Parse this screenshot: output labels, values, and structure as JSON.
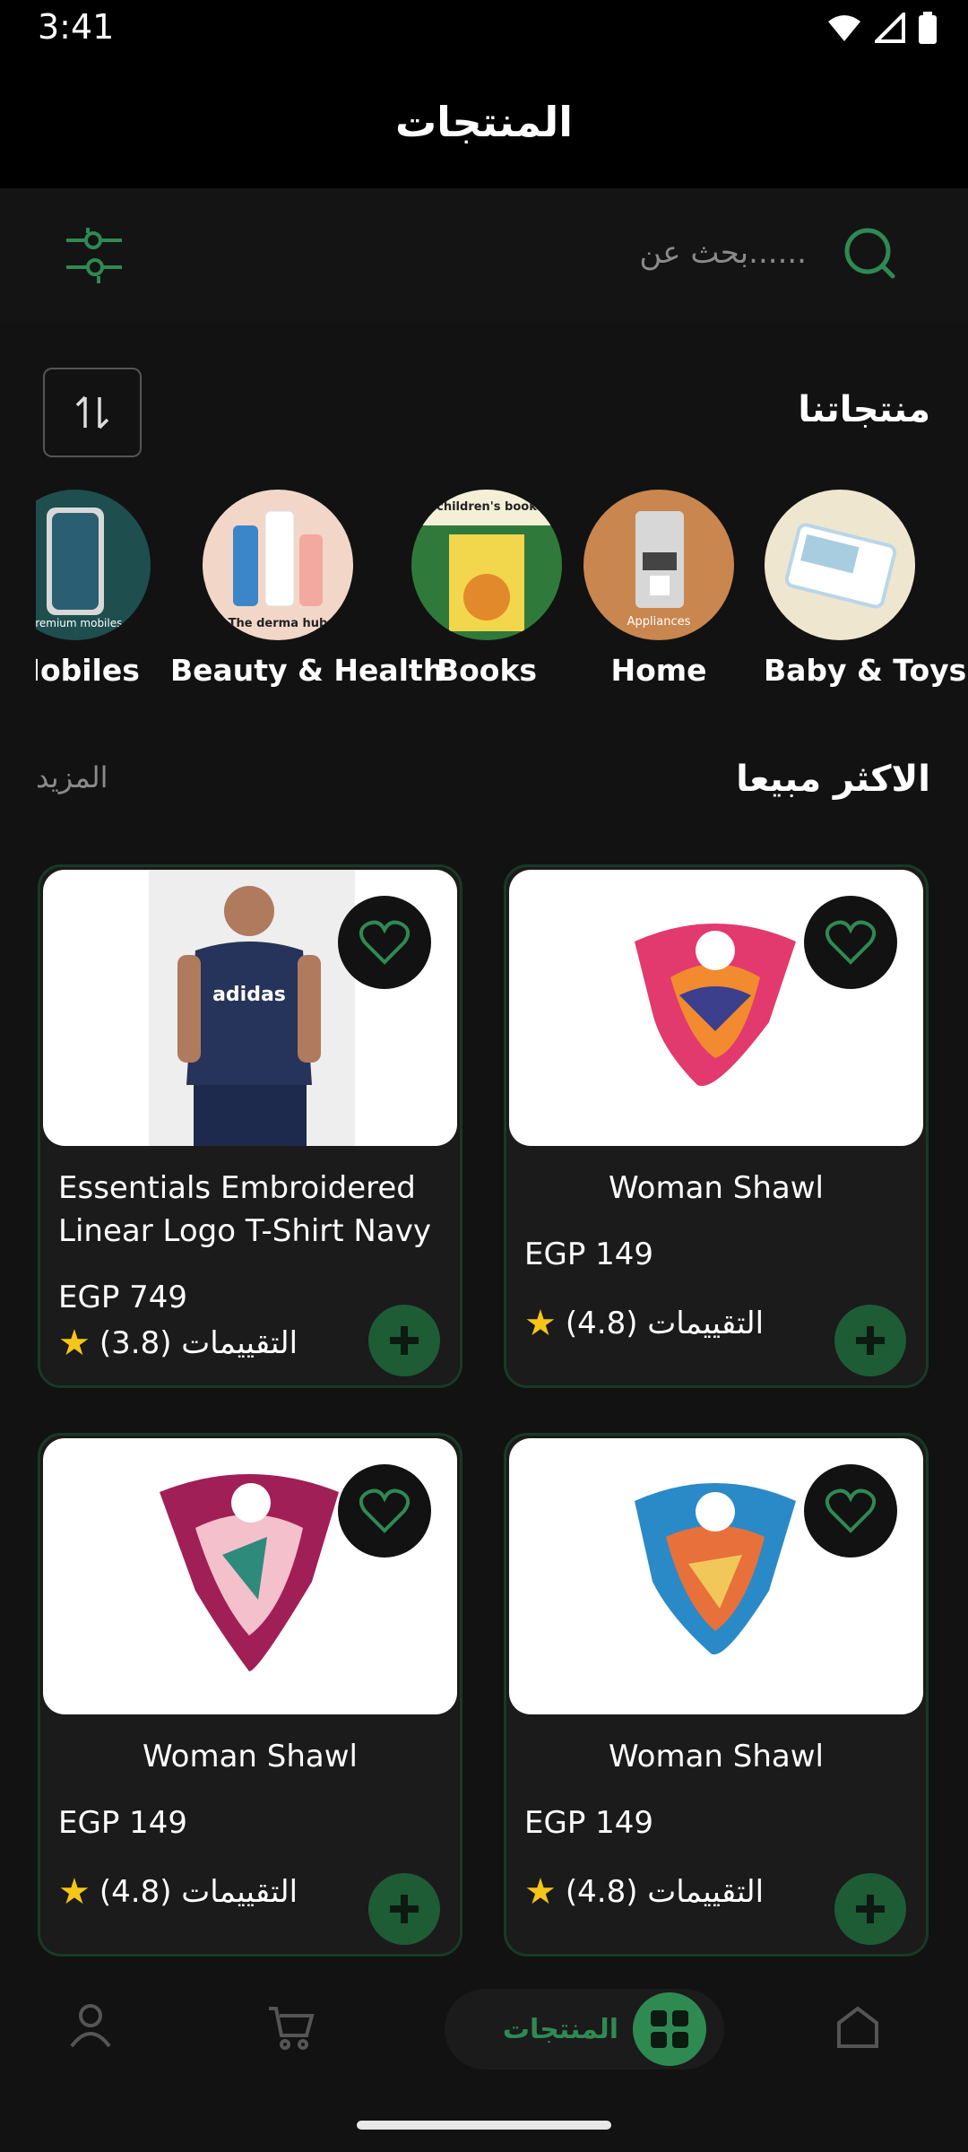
{
  "status_bar": {
    "time": "3:41"
  },
  "app_bar": {
    "title": "المنتجات"
  },
  "search": {
    "placeholder": "بحث عن......"
  },
  "categories_section": {
    "title": "منتجاتنا"
  },
  "categories": [
    {
      "label": "Baby & Toys"
    },
    {
      "label": "Home",
      "image_caption": "Appliances"
    },
    {
      "label": "Books",
      "image_caption": "children's book"
    },
    {
      "label": "Beauty & Health",
      "image_caption": "The derma hub"
    },
    {
      "label": "Mobiles",
      "image_caption": "premium mobiles"
    }
  ],
  "best_sellers": {
    "title": "الاكثر مبيعا",
    "more_label": "المزيد"
  },
  "products": [
    {
      "name": "Essentials Embroidered Linear Logo T-Shirt Navy",
      "price": "EGP 749",
      "rating_text": "التقييمات (3.8)",
      "shirt_brand": "adidas"
    },
    {
      "name": "Woman Shawl",
      "price": "EGP 149",
      "rating_text": "التقييمات (4.8)"
    },
    {
      "name": "Woman Shawl",
      "price": "EGP 149",
      "rating_text": "التقييمات (4.8)"
    },
    {
      "name": "Woman Shawl",
      "price": "EGP 149",
      "rating_text": "التقييمات (4.8)"
    }
  ],
  "bottom_nav": {
    "active_label": "المنتجات"
  },
  "colors": {
    "accent": "#2e8a52",
    "background": "#121212",
    "card_border": "#173a26"
  }
}
